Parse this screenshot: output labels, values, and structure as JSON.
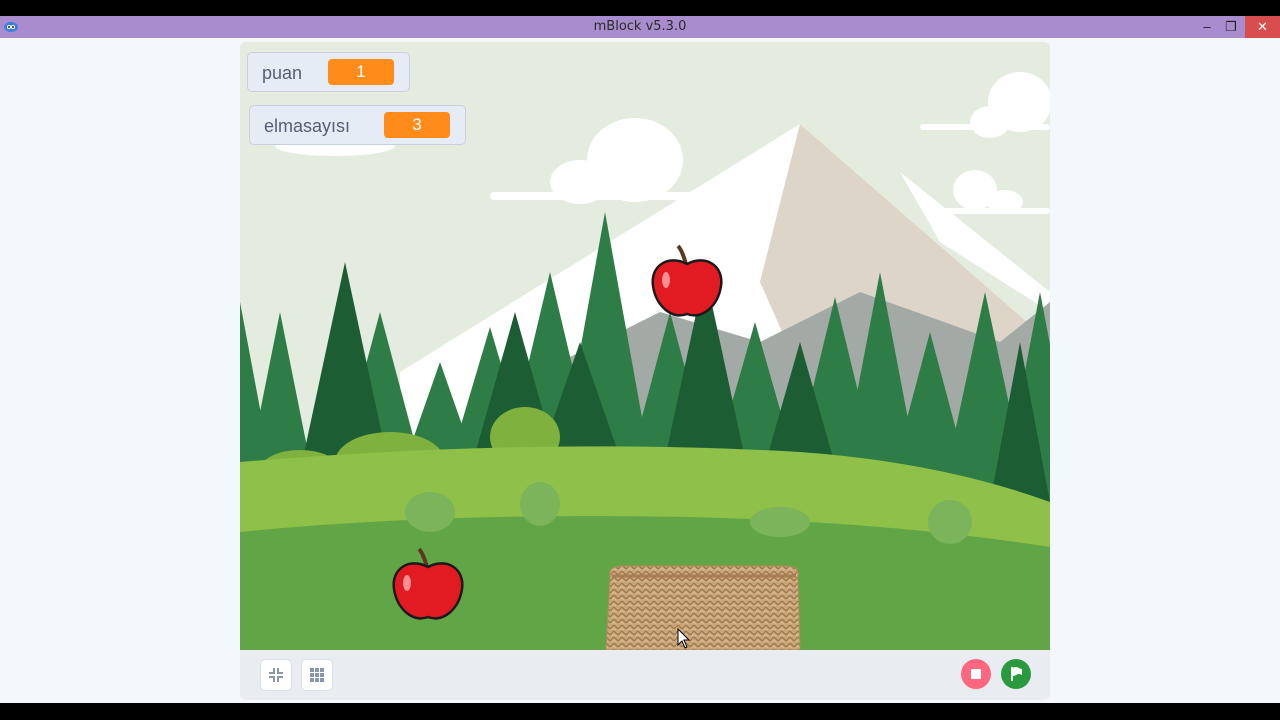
{
  "window": {
    "title": "mBlock v5.3.0",
    "minimize_glyph": "–",
    "maximize_glyph": "❐",
    "close_glyph": "✕"
  },
  "monitors": [
    {
      "label": "puan",
      "value": "1"
    },
    {
      "label": "elmasayısı",
      "value": "3"
    }
  ],
  "sprites": {
    "apple": "apple",
    "basket": "woven-basket"
  },
  "controls": {
    "small_stage_icon": "shrink-stage-icon",
    "grid_icon": "grid-icon",
    "stop_icon": "stop-icon",
    "flag_icon": "green-flag-icon"
  },
  "colors": {
    "title_bar": "#a98ccd",
    "monitor_value": "#ff8c1a",
    "stop_button": "#ff6680",
    "go_button": "#2b9a3e",
    "sky": "#e4ecdf",
    "grass": "#62a546"
  }
}
